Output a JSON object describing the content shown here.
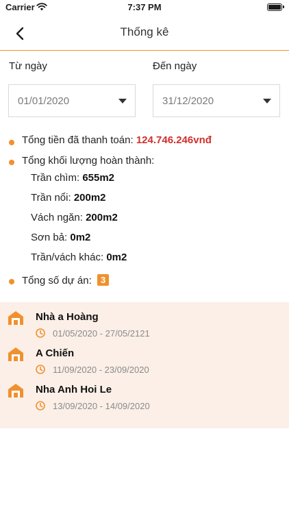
{
  "status_bar": {
    "carrier": "Carrier",
    "time": "7:37 PM"
  },
  "nav": {
    "title": "Thống kê"
  },
  "filters": {
    "from_label": "Từ ngày",
    "to_label": "Đến ngày",
    "from_value": "01/01/2020",
    "to_value": "31/12/2020"
  },
  "stats": {
    "paid_label": "Tổng tiền đã thanh toán:",
    "paid_value": "124.746.246vnđ",
    "volume_label": "Tổng khối lượng hoàn thành:",
    "volume_items": [
      {
        "label": "Trần chìm:",
        "value": "655m2"
      },
      {
        "label": "Trần nổi:",
        "value": "200m2"
      },
      {
        "label": "Vách ngăn:",
        "value": "200m2"
      },
      {
        "label": "Sơn bả:",
        "value": "0m2"
      },
      {
        "label": "Trần/vách khác:",
        "value": "0m2"
      }
    ],
    "projects_label": "Tổng số dự án:",
    "projects_count": "3"
  },
  "projects": [
    {
      "name": "Nhà a Hoàng",
      "dates": "01/05/2020 - 27/05/2121"
    },
    {
      "name": "A Chiến",
      "dates": "11/09/2020 - 23/09/2020"
    },
    {
      "name": "Nha Anh Hoi Le",
      "dates": "13/09/2020 - 14/09/2020"
    }
  ],
  "colors": {
    "accent": "#f0912e",
    "money": "#d0312d",
    "list_bg": "#fbefe8"
  },
  "icons": {
    "back": "chevron-left-icon",
    "dropdown": "caret-down-icon",
    "project": "home-icon",
    "date": "clock-icon"
  }
}
